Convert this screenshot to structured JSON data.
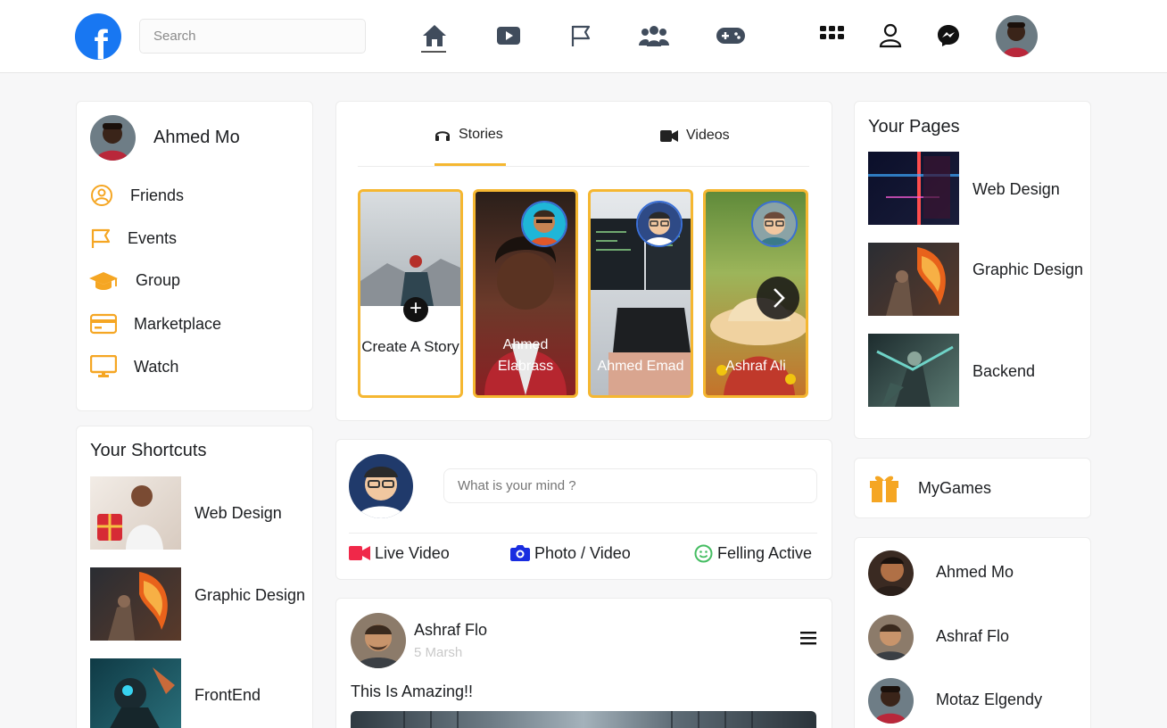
{
  "header": {
    "logo_letter": "f",
    "search_placeholder": "Search"
  },
  "nav_icons": [
    "home-icon",
    "video-icon",
    "flag-icon",
    "people-icon",
    "gamepad-icon"
  ],
  "right_icons": [
    "grid-menu-icon",
    "user-icon",
    "messenger-icon"
  ],
  "profile": {
    "name": "Ahmed Mo"
  },
  "sidebar": {
    "items": [
      {
        "label": "Friends",
        "icon": "friends-icon"
      },
      {
        "label": "Events",
        "icon": "flag-icon"
      },
      {
        "label": "Group",
        "icon": "graduation-cap-icon"
      },
      {
        "label": "Marketplace",
        "icon": "card-icon"
      },
      {
        "label": "Watch",
        "icon": "monitor-icon"
      }
    ]
  },
  "shortcuts": {
    "title": "Your Shortcuts",
    "items": [
      "Web Design",
      "Graphic Design",
      "FrontEnd"
    ]
  },
  "stories": {
    "tabs": [
      "Stories",
      "Videos"
    ],
    "create_label": "Create A Story",
    "items": [
      "Ahmed Elabrass",
      "Ahmed Emad",
      "Ashraf Ali"
    ]
  },
  "composer": {
    "placeholder": "What is your mind ?",
    "actions": [
      "Live Video",
      "Photo / Video",
      "Felling Active"
    ]
  },
  "post": {
    "author": "Ashraf Flo",
    "date": "5 Marsh",
    "text": "This Is Amazing!!"
  },
  "pages": {
    "title": "Your Pages",
    "items": [
      "Web Design",
      "Graphic Design",
      "Backend"
    ]
  },
  "games": {
    "label": "MyGames"
  },
  "contacts": [
    "Ahmed Mo",
    "Ashraf Flo",
    "Motaz Elgendy"
  ],
  "colors": {
    "brand": "#1877f2",
    "accent": "#f5b731",
    "live": "#f02849",
    "photo": "#1a2de0",
    "feeling": "#45bd62"
  }
}
